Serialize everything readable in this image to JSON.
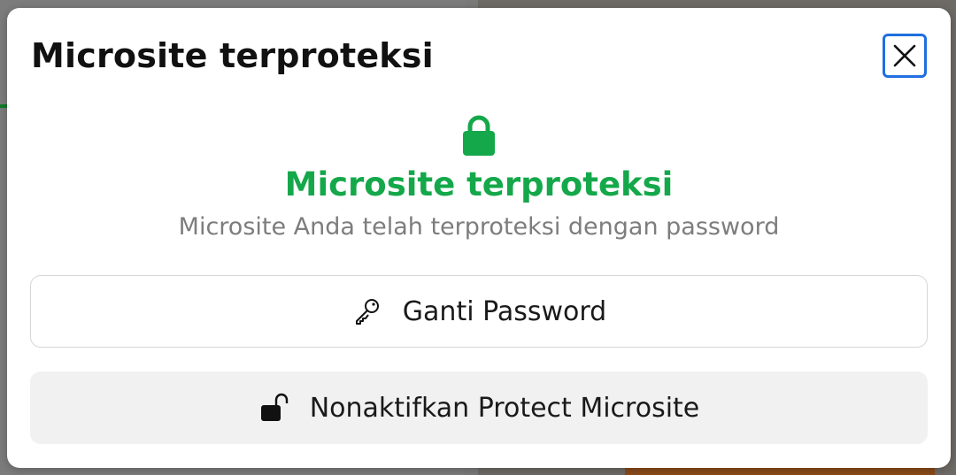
{
  "modal": {
    "title": "Microsite terproteksi",
    "close_icon": "close-icon"
  },
  "status": {
    "icon": "lock-icon",
    "title": "Microsite terproteksi",
    "subtitle": "Microsite Anda telah terproteksi dengan password",
    "accent_color": "#14a84a"
  },
  "actions": {
    "change_password": {
      "icon": "key-icon",
      "label": "Ganti Password"
    },
    "disable_protect": {
      "icon": "unlock-icon",
      "label": "Nonaktifkan Protect Microsite"
    }
  },
  "colors": {
    "focus_ring": "#1f6fe0",
    "secondary_button_bg": "#f1f1f1"
  }
}
